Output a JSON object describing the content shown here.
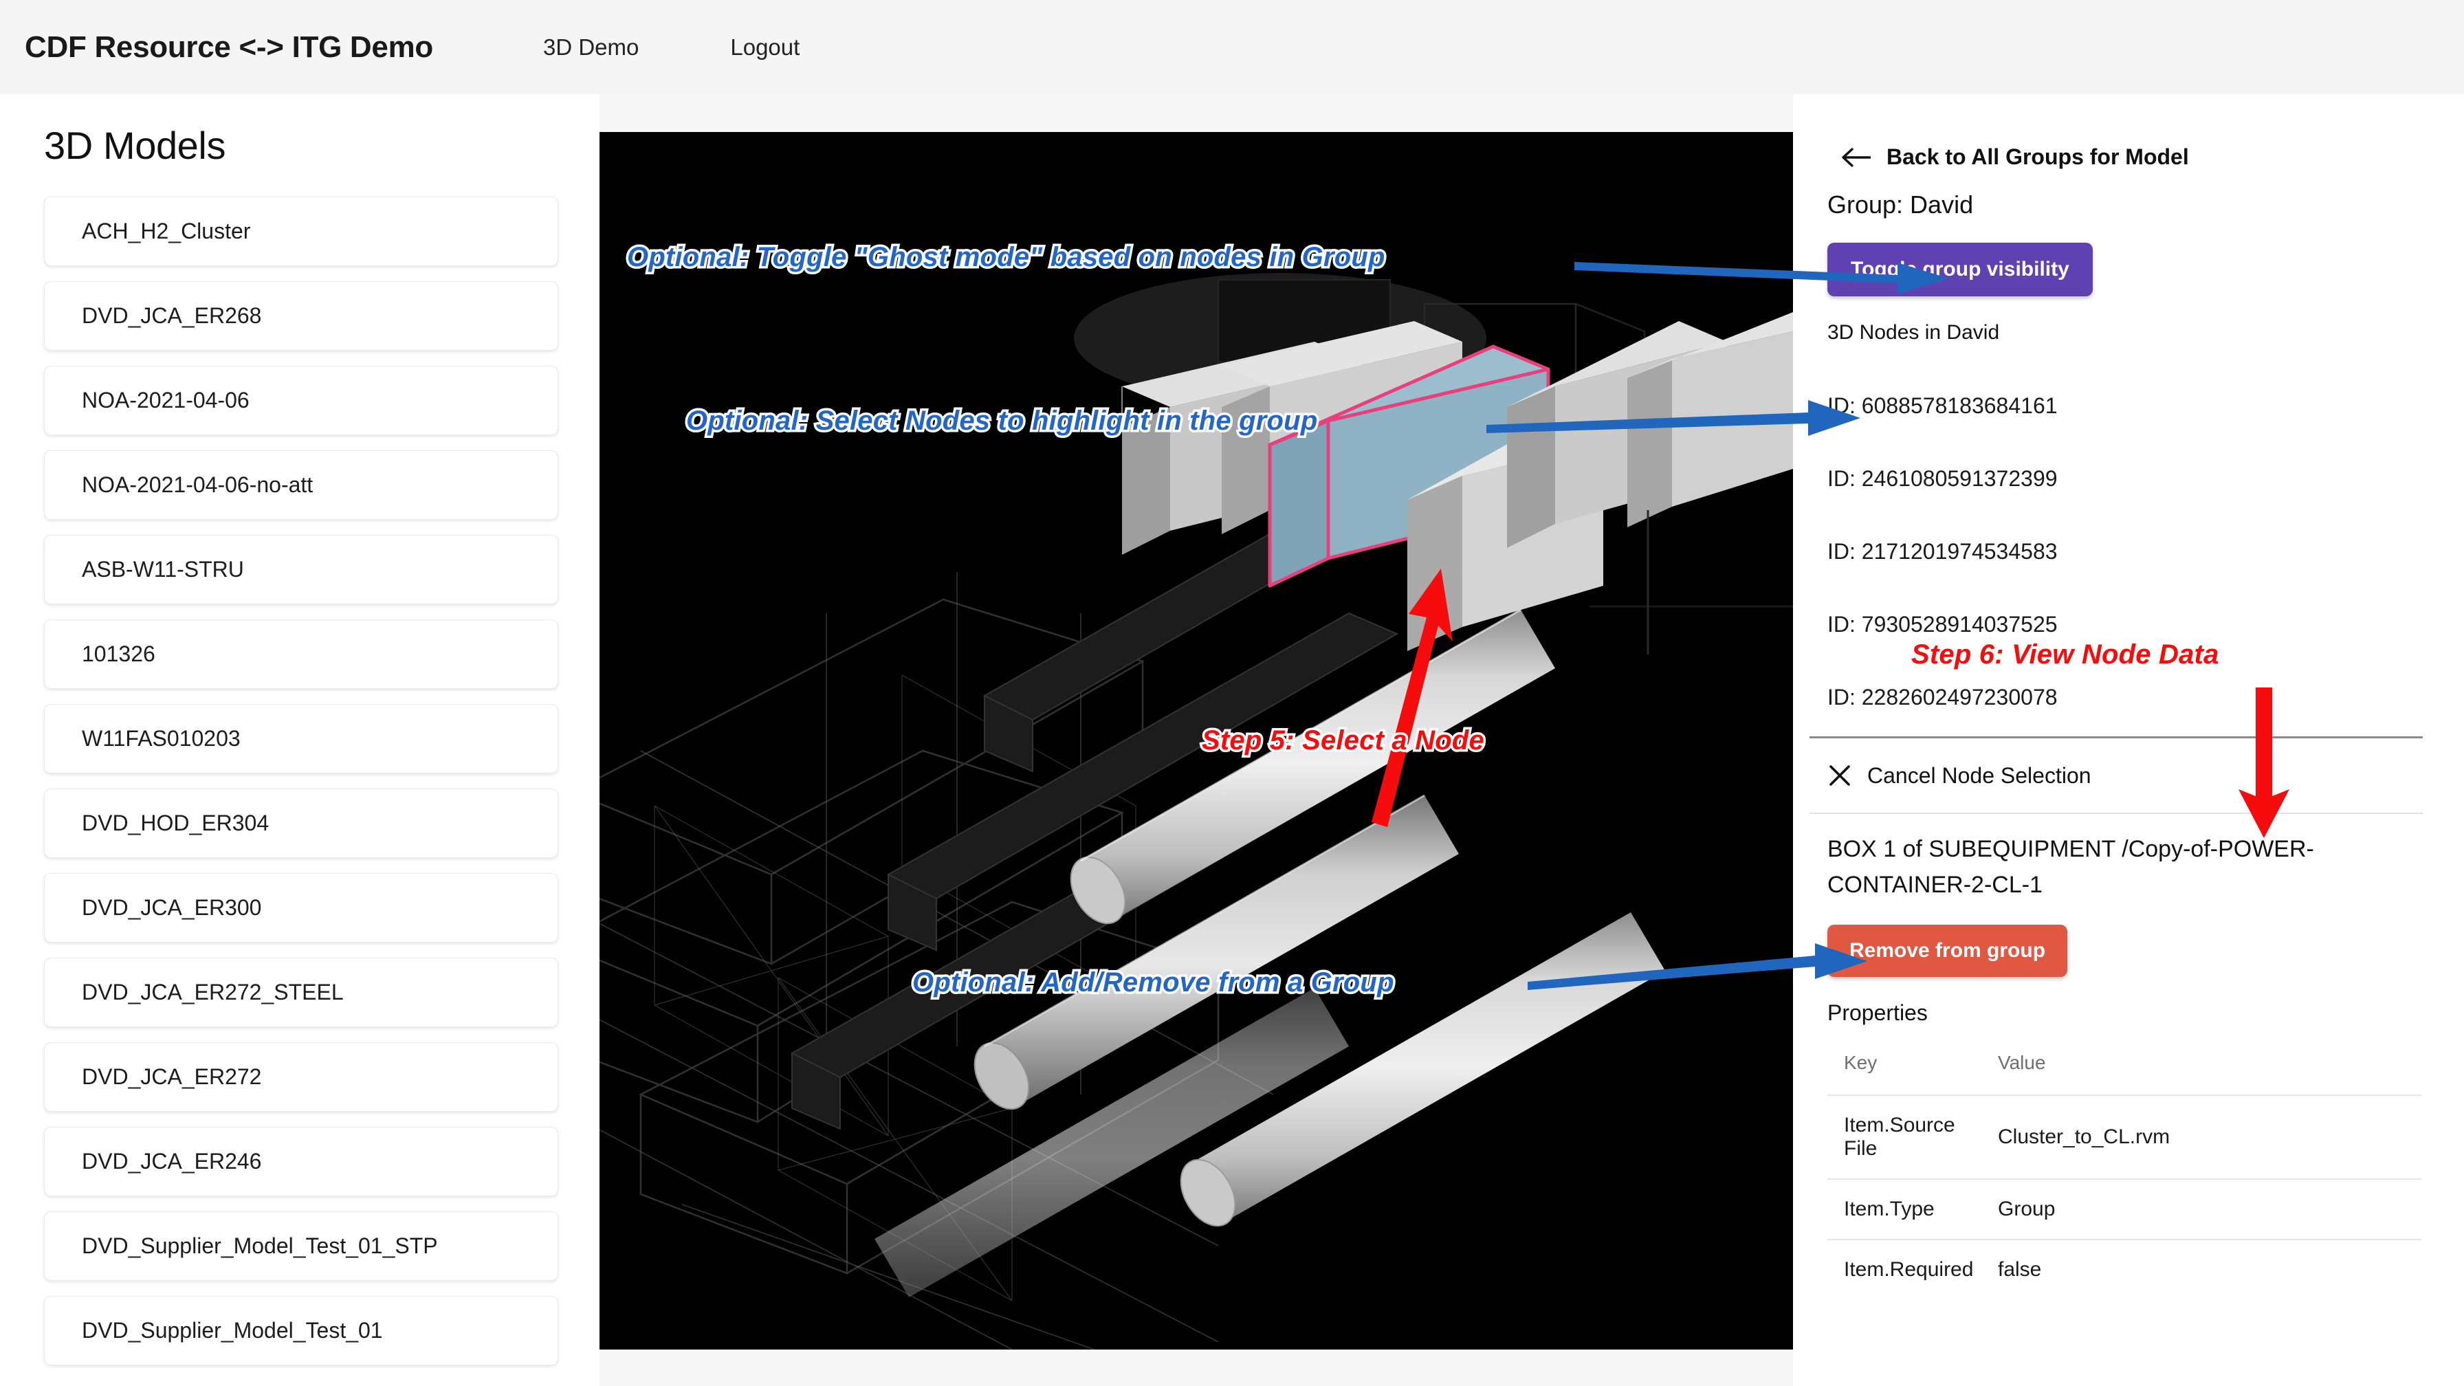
{
  "navbar": {
    "brand": "CDF Resource <-> ITG Demo",
    "links": [
      {
        "label": "3D Demo"
      },
      {
        "label": "Logout"
      }
    ]
  },
  "sidebar": {
    "title": "3D Models",
    "models": [
      {
        "label": "ACH_H2_Cluster"
      },
      {
        "label": "DVD_JCA_ER268"
      },
      {
        "label": "NOA-2021-04-06"
      },
      {
        "label": "NOA-2021-04-06-no-att"
      },
      {
        "label": "ASB-W11-STRU"
      },
      {
        "label": "101326"
      },
      {
        "label": "W11FAS010203"
      },
      {
        "label": "DVD_HOD_ER304"
      },
      {
        "label": "DVD_JCA_ER300"
      },
      {
        "label": "DVD_JCA_ER272_STEEL"
      },
      {
        "label": "DVD_JCA_ER272"
      },
      {
        "label": "DVD_JCA_ER246"
      },
      {
        "label": "DVD_Supplier_Model_Test_01_STP"
      },
      {
        "label": "DVD_Supplier_Model_Test_01"
      }
    ]
  },
  "viewport": {
    "background_color": "#000000",
    "highlight_fill": "#8fb2c4",
    "highlight_outline": "#e8407a"
  },
  "annotations": {
    "ghost_mode": "Optional: Toggle \"Ghost mode\" based on nodes in Group",
    "select_nodes": "Optional: Select Nodes to highlight in the group",
    "step5": "Step 5:  Select a Node",
    "add_remove": "Optional: Add/Remove from a Group",
    "step6": "Step 6: View Node Data",
    "blue_color": "#2466c7",
    "red_color": "#fa0a0a"
  },
  "panel": {
    "back_label": "Back to All Groups for Model",
    "group_label": "Group: David",
    "toggle_visibility_label": "Toggle group visibility",
    "toggle_visibility_color": "#5f41b2",
    "nodes_heading": "3D Nodes in David",
    "nodes": [
      {
        "label": "ID: 6088578183684161"
      },
      {
        "label": "ID: 2461080591372399"
      },
      {
        "label": "ID: 2171201974534583"
      },
      {
        "label": "ID: 7930528914037525"
      },
      {
        "label": "ID: 2282602497230078"
      }
    ],
    "cancel_label": "Cancel Node Selection",
    "selected_node_title": "BOX 1 of SUBEQUIPMENT /Copy-of-POWER-CONTAINER-2-CL-1",
    "remove_label": "Remove from group",
    "remove_color": "#e05742",
    "properties_heading": "Properties",
    "properties_columns": {
      "key": "Key",
      "value": "Value"
    },
    "properties": [
      {
        "key": "Item.Source File",
        "value": "Cluster_to_CL.rvm"
      },
      {
        "key": "Item.Type",
        "value": "Group"
      },
      {
        "key": "Item.Required",
        "value": "false"
      }
    ]
  }
}
